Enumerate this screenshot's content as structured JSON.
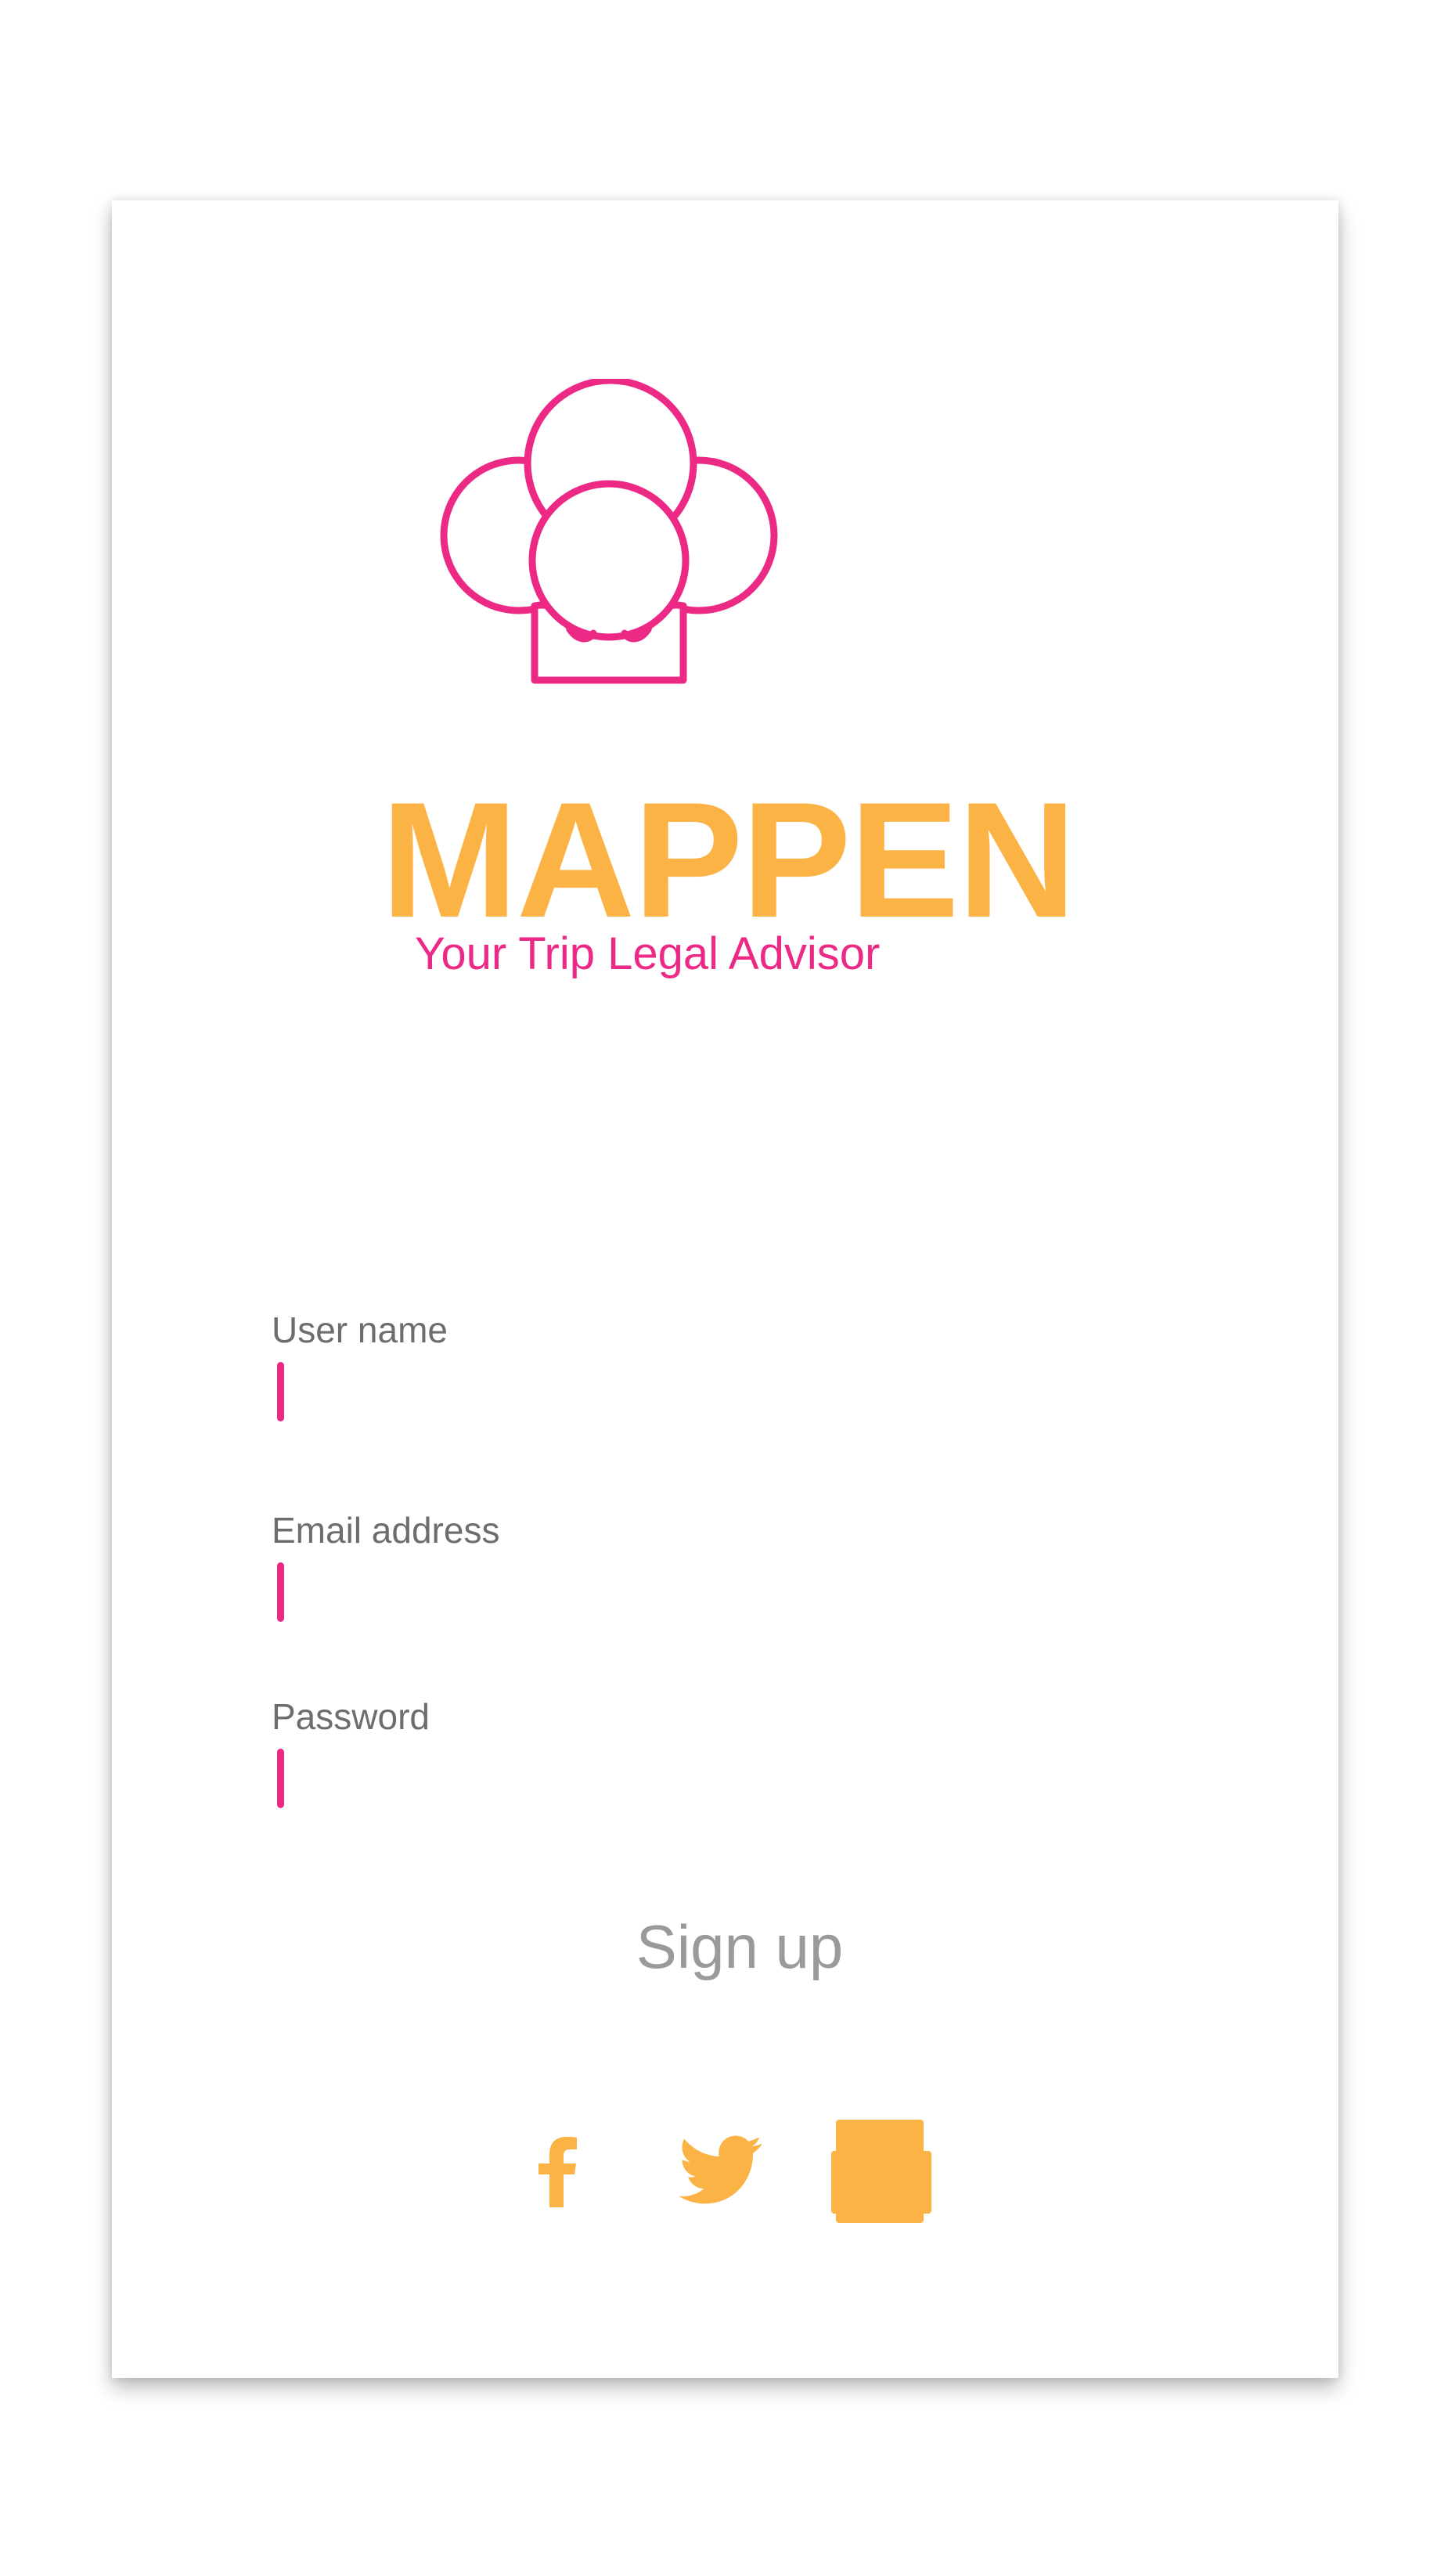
{
  "brand": {
    "name": "MAPPEN",
    "tagline": "Your Trip Legal Advisor",
    "logo_icon": "chef-hat-balloon-icon"
  },
  "form": {
    "fields": [
      {
        "label": "User name",
        "value": ""
      },
      {
        "label": "Email address",
        "value": ""
      },
      {
        "label": "Password",
        "value": ""
      }
    ],
    "submit_label": "Sign up"
  },
  "social": [
    {
      "icon": "facebook-icon"
    },
    {
      "icon": "twitter-icon"
    },
    {
      "icon": "square-icon"
    }
  ],
  "colors": {
    "accent_orange": "#fbb346",
    "accent_pink": "#ec2a86",
    "label_gray": "#6d6d6d",
    "button_gray": "#9a9a9a"
  }
}
